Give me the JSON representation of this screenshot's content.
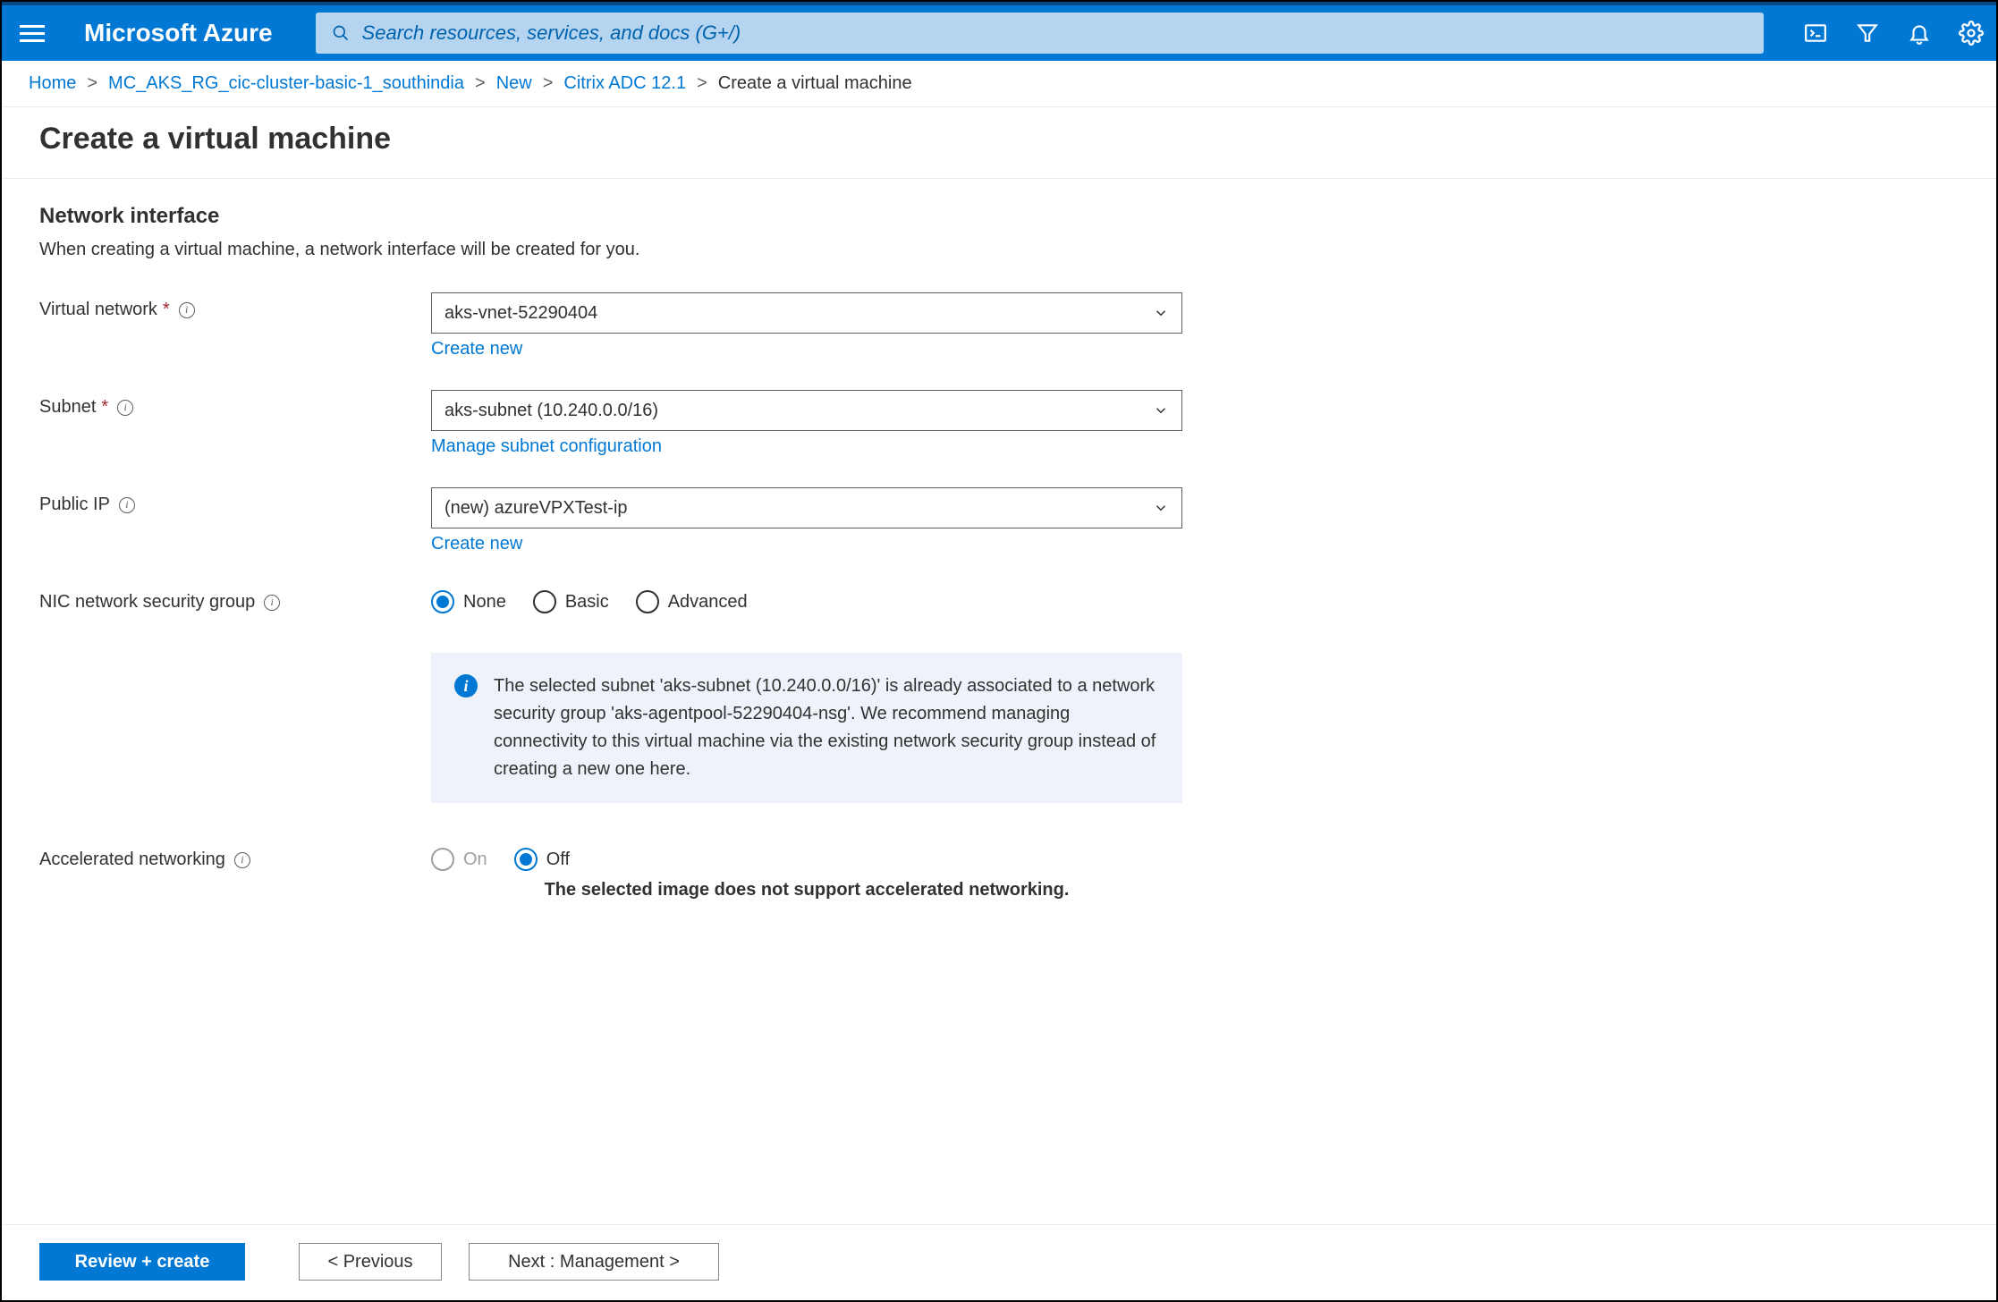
{
  "header": {
    "brand": "Microsoft Azure",
    "search_placeholder": "Search resources, services, and docs (G+/)"
  },
  "breadcrumb": {
    "items": [
      {
        "label": "Home",
        "link": true
      },
      {
        "label": "MC_AKS_RG_cic-cluster-basic-1_southindia",
        "link": true
      },
      {
        "label": "New",
        "link": true
      },
      {
        "label": "Citrix ADC 12.1",
        "link": true
      },
      {
        "label": "Create a virtual machine",
        "link": false
      }
    ]
  },
  "page": {
    "title": "Create a virtual machine"
  },
  "section": {
    "heading": "Network interface",
    "description": "When creating a virtual machine, a network interface will be created for you."
  },
  "fields": {
    "virtual_network": {
      "label": "Virtual network",
      "required": true,
      "value": "aks-vnet-52290404",
      "create_link": "Create new"
    },
    "subnet": {
      "label": "Subnet",
      "required": true,
      "value": "aks-subnet (10.240.0.0/16)",
      "manage_link": "Manage subnet configuration"
    },
    "public_ip": {
      "label": "Public IP",
      "required": false,
      "value": "(new) azureVPXTest-ip",
      "create_link": "Create new"
    },
    "nsg": {
      "label": "NIC network security group",
      "options": {
        "none": "None",
        "basic": "Basic",
        "advanced": "Advanced"
      },
      "selected": "none"
    },
    "info_banner": "The selected subnet 'aks-subnet (10.240.0.0/16)' is already associated to a network security group 'aks-agentpool-52290404-nsg'. We recommend managing connectivity to this virtual machine via the existing network security group instead of creating a new one here.",
    "accel_net": {
      "label": "Accelerated networking",
      "options": {
        "on": "On",
        "off": "Off"
      },
      "selected": "off",
      "note": "The selected image does not support accelerated networking."
    }
  },
  "footer": {
    "review": "Review + create",
    "previous": "< Previous",
    "next": "Next : Management >"
  }
}
